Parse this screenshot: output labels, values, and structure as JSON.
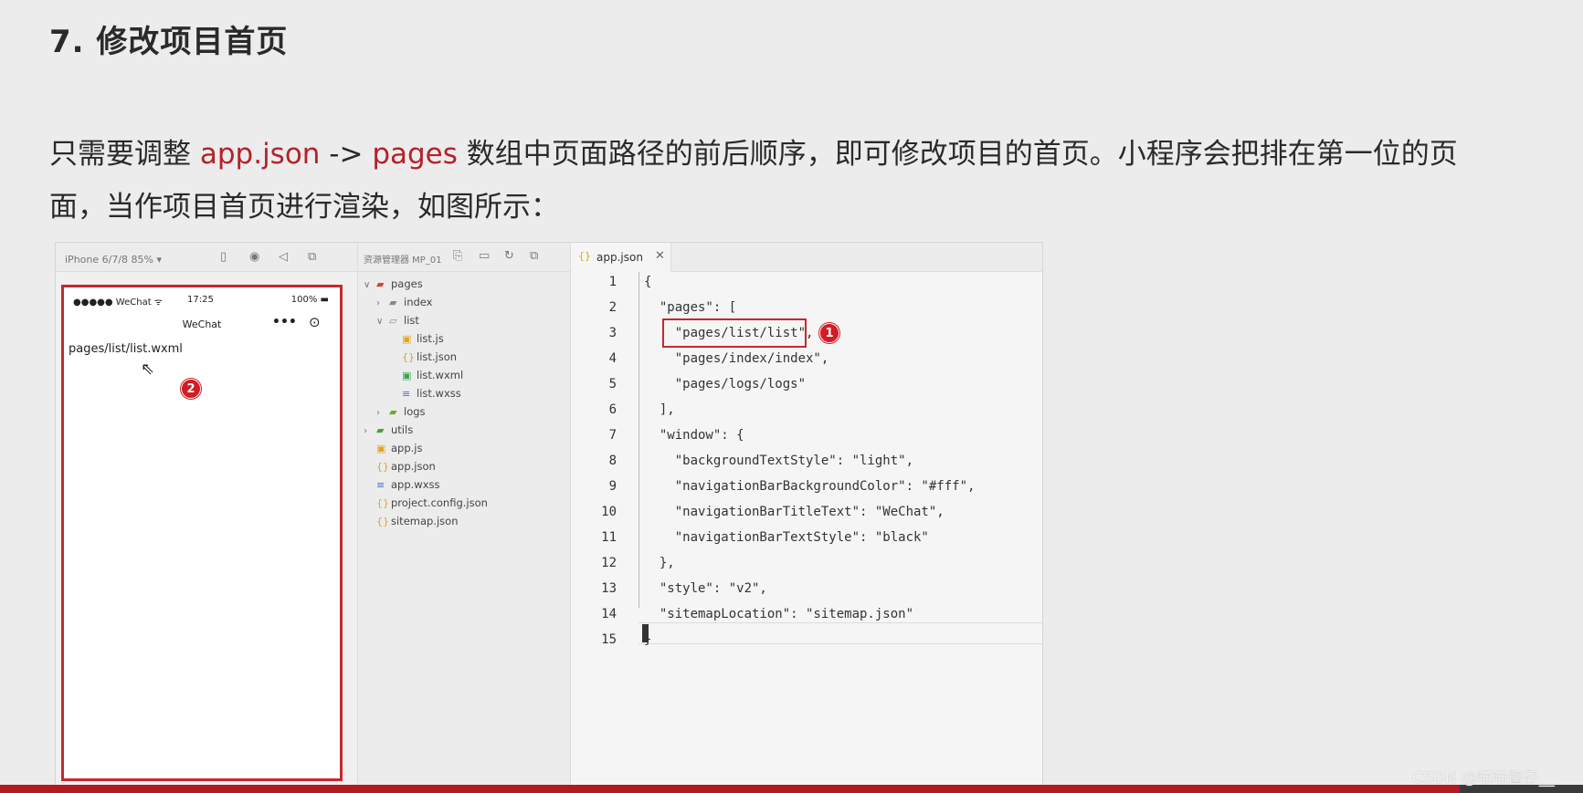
{
  "heading": "7. 修改项目首页",
  "paragraph": {
    "line1_pre": "只需要调整 ",
    "hl1": "app.json",
    "arrow": " -> ",
    "hl2": "pages",
    "line1_post": " 数组中页面路径的前后顺序，即可修改项目的首页。小程序会把排在第一位的页",
    "line2": "面，当作项目首页进行渲染，如图所示："
  },
  "simulator": {
    "device_label": "iPhone 6/7/8 85% ▾",
    "carrier": "●●●●● WeChat ᯤ",
    "time": "17:25",
    "battery": "100% ▬",
    "nav_title": "WeChat",
    "capsule_more": "•••",
    "capsule_close": "⊙",
    "page_text": "pages/list/list.wxml",
    "badge": "2"
  },
  "explorer": {
    "title": "资源管理器 MP_01",
    "items": [
      {
        "chevron": "∨",
        "icon": "▰",
        "label": "pages"
      },
      {
        "chevron": "›",
        "icon": "▰",
        "label": "index"
      },
      {
        "chevron": "∨",
        "icon": "▱",
        "label": "list"
      },
      {
        "chevron": "",
        "icon": "▣",
        "label": "list.js"
      },
      {
        "chevron": "",
        "icon": "{}",
        "label": "list.json"
      },
      {
        "chevron": "",
        "icon": "▣",
        "label": "list.wxml"
      },
      {
        "chevron": "",
        "icon": "≡",
        "label": "list.wxss"
      },
      {
        "chevron": "›",
        "icon": "▰",
        "label": "logs"
      },
      {
        "chevron": "›",
        "icon": "▰",
        "label": "utils"
      },
      {
        "chevron": "",
        "icon": "▣",
        "label": "app.js"
      },
      {
        "chevron": "",
        "icon": "{}",
        "label": "app.json"
      },
      {
        "chevron": "",
        "icon": "≡",
        "label": "app.wxss"
      },
      {
        "chevron": "",
        "icon": "{}",
        "label": "project.config.json"
      },
      {
        "chevron": "",
        "icon": "{}",
        "label": "sitemap.json"
      }
    ]
  },
  "editor": {
    "tab_icon": "{}",
    "tab_name": "app.json",
    "tab_close": "✕",
    "line_numbers": [
      "1",
      "2",
      "3",
      "4",
      "5",
      "6",
      "7",
      "8",
      "9",
      "10",
      "11",
      "12",
      "13",
      "14",
      "15"
    ],
    "lines": [
      "{",
      "  \"pages\": [",
      "    \"pages/list/list\",",
      "    \"pages/index/index\",",
      "    \"pages/logs/logs\"",
      "  ],",
      "  \"window\": {",
      "    \"backgroundTextStyle\": \"light\",",
      "    \"navigationBarBackgroundColor\": \"#fff\",",
      "    \"navigationBarTitleText\": \"WeChat\",",
      "    \"navigationBarTextStyle\": \"black\"",
      "  },",
      "  \"style\": \"v2\",",
      "  \"sitemapLocation\": \"sitemap.json\"",
      "}"
    ],
    "badge": "1"
  },
  "watermark": "CSDN @喵喵酱仔__",
  "colors": {
    "accent_red": "#b4222b",
    "frame_red": "#c6282f"
  }
}
